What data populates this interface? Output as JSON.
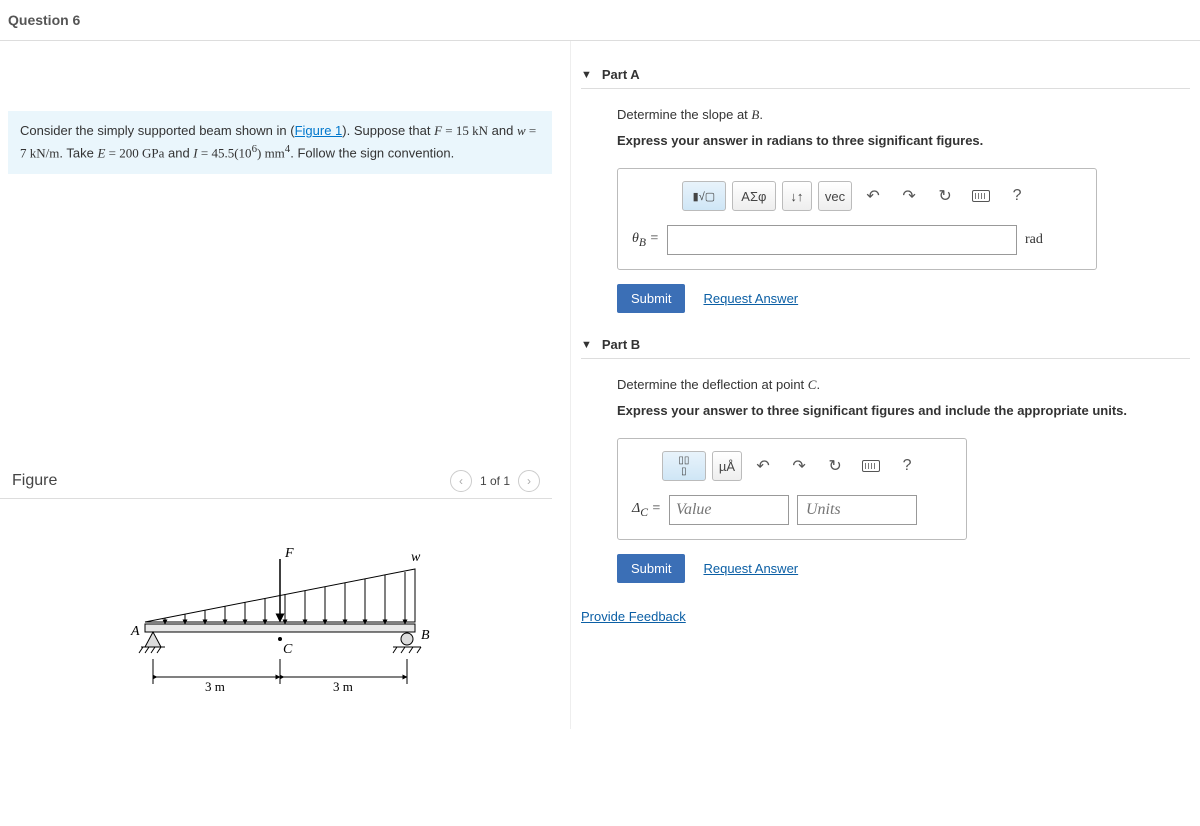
{
  "question": {
    "label": "Question 6"
  },
  "prompt": {
    "intro": "Consider the simply supported beam shown in (",
    "figure_link": "Figure 1",
    "after_link": "). Suppose that ",
    "F_eq": "F",
    "F_val": " = 15 kN",
    "and1": " and ",
    "w_eq": "w",
    "w_val": " = 7 kN/m",
    "take": ". Take ",
    "E_eq": "E",
    "E_val": " = 200 GPa",
    "and2": " and ",
    "I_eq": "I",
    "I_val": " = 45.5(10",
    "I_exp": "6",
    "I_unit": ") mm",
    "I_exp2": "4",
    "tail": ". Follow the sign convention."
  },
  "figure": {
    "heading": "Figure",
    "counter": "1 of 1",
    "labels": {
      "F": "F",
      "w": "w",
      "A": "A",
      "B": "B",
      "C": "C",
      "d1": "3 m",
      "d2": "3 m"
    }
  },
  "partA": {
    "title": "Part A",
    "line1_pre": "Determine the slope at ",
    "line1_var": "B",
    "line1_post": ".",
    "line2": "Express your answer in radians to three significant figures.",
    "toolbar": {
      "tpl": "▢",
      "sqrt": "√▢",
      "greek": "ΑΣφ",
      "sort": "↓↑",
      "vec": "vec",
      "undo": "↶",
      "redo": "↷",
      "reset": "↻",
      "kbd": "kbd",
      "help": "?"
    },
    "lhs": "θ_B =",
    "unit": "rad",
    "submit": "Submit",
    "request": "Request Answer"
  },
  "partB": {
    "title": "Part B",
    "line1_pre": "Determine the deflection at point ",
    "line1_var": "C",
    "line1_post": ".",
    "line2": "Express your answer to three significant figures and include the appropriate units.",
    "toolbar": {
      "tpl": "▢",
      "units": "µÅ",
      "undo": "↶",
      "redo": "↷",
      "reset": "↻",
      "kbd": "kbd",
      "help": "?"
    },
    "lhs": "Δ_C =",
    "value_ph": "Value",
    "units_ph": "Units",
    "submit": "Submit",
    "request": "Request Answer"
  },
  "feedback": "Provide Feedback"
}
